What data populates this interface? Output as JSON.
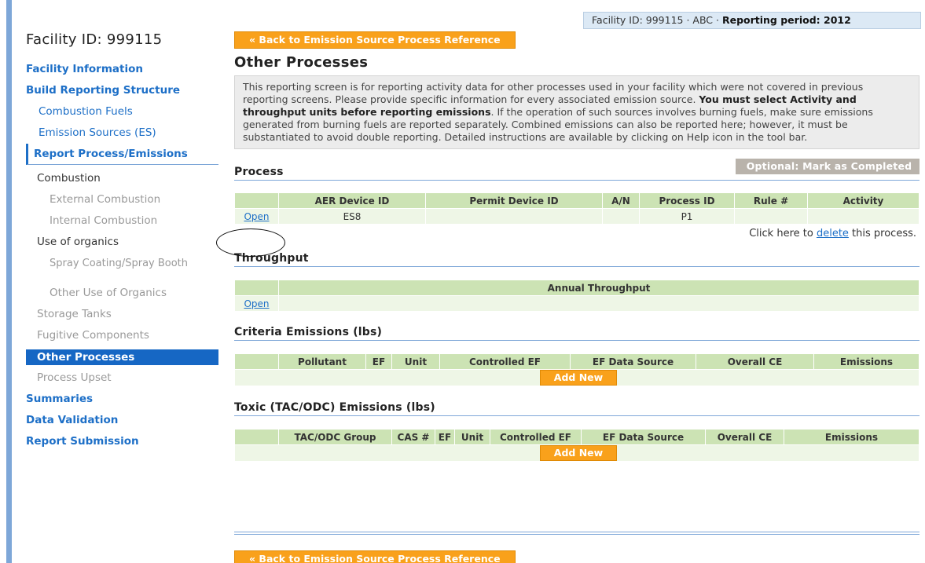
{
  "header": {
    "facility_label": "Facility ID: 999115 · ABC · ",
    "period_label": "Reporting period: 2012"
  },
  "sidebar": {
    "title": "Facility ID: 999115",
    "items": [
      {
        "label": "Facility Information"
      },
      {
        "label": "Build Reporting Structure"
      },
      {
        "label": "Combustion Fuels"
      },
      {
        "label": "Emission Sources (ES)"
      },
      {
        "label": "Report Process/Emissions"
      },
      {
        "label": "Combustion"
      },
      {
        "label": "External Combustion"
      },
      {
        "label": "Internal Combustion"
      },
      {
        "label": "Use of organics"
      },
      {
        "label": "Spray Coating/Spray Booth"
      },
      {
        "label": "Other Use of Organics"
      },
      {
        "label": "Storage Tanks"
      },
      {
        "label": "Fugitive Components"
      },
      {
        "label": "Other Processes"
      },
      {
        "label": "Process Upset"
      },
      {
        "label": "Summaries"
      },
      {
        "label": "Data Validation"
      },
      {
        "label": "Report Submission"
      }
    ]
  },
  "main": {
    "back_button": "« Back to Emission Source Process Reference",
    "title": "Other Processes",
    "desc_part1": "This reporting screen is for reporting activity data for other processes used in your facility which were not covered in previous reporting screens. Please provide specific information for every associated emission source. ",
    "desc_bold": "You must select Activity and throughput units before reporting emissions",
    "desc_part2": ". If the operation of such sources involves burning fuels, make sure emissions generated from burning fuels are reported separately. Combined emissions can also be reported here; however, it must be substantiated to avoid double reporting. Detailed instructions are available by clicking on Help icon in the tool bar."
  },
  "process": {
    "heading": "Process",
    "mark_button": "Optional: Mark as Completed",
    "columns": [
      "",
      "AER Device ID",
      "Permit Device ID",
      "A/N",
      "Process ID",
      "Rule #",
      "Activity"
    ],
    "row": {
      "open": "Open",
      "aer": "ES8",
      "permit": "",
      "an": "",
      "process_id": "P1",
      "rule": "",
      "activity": ""
    },
    "delete_prefix": "Click here to ",
    "delete_link": "delete",
    "delete_suffix": " this process."
  },
  "throughput": {
    "heading": "Throughput",
    "columns": [
      "",
      "Annual Throughput"
    ],
    "open": "Open"
  },
  "criteria": {
    "heading": "Criteria Emissions (lbs)",
    "columns": [
      "",
      "Pollutant",
      "EF",
      "Unit",
      "Controlled EF",
      "EF Data Source",
      "Overall CE",
      "Emissions"
    ],
    "add_button": "Add New"
  },
  "toxic": {
    "heading": "Toxic (TAC/ODC) Emissions (lbs)",
    "columns": [
      "",
      "TAC/ODC Group",
      "CAS #",
      "EF",
      "Unit",
      "Controlled EF",
      "EF Data Source",
      "Overall CE",
      "Emissions"
    ],
    "add_button": "Add New"
  },
  "footer": {
    "back_button": "« Back to Emission Source Process Reference"
  }
}
